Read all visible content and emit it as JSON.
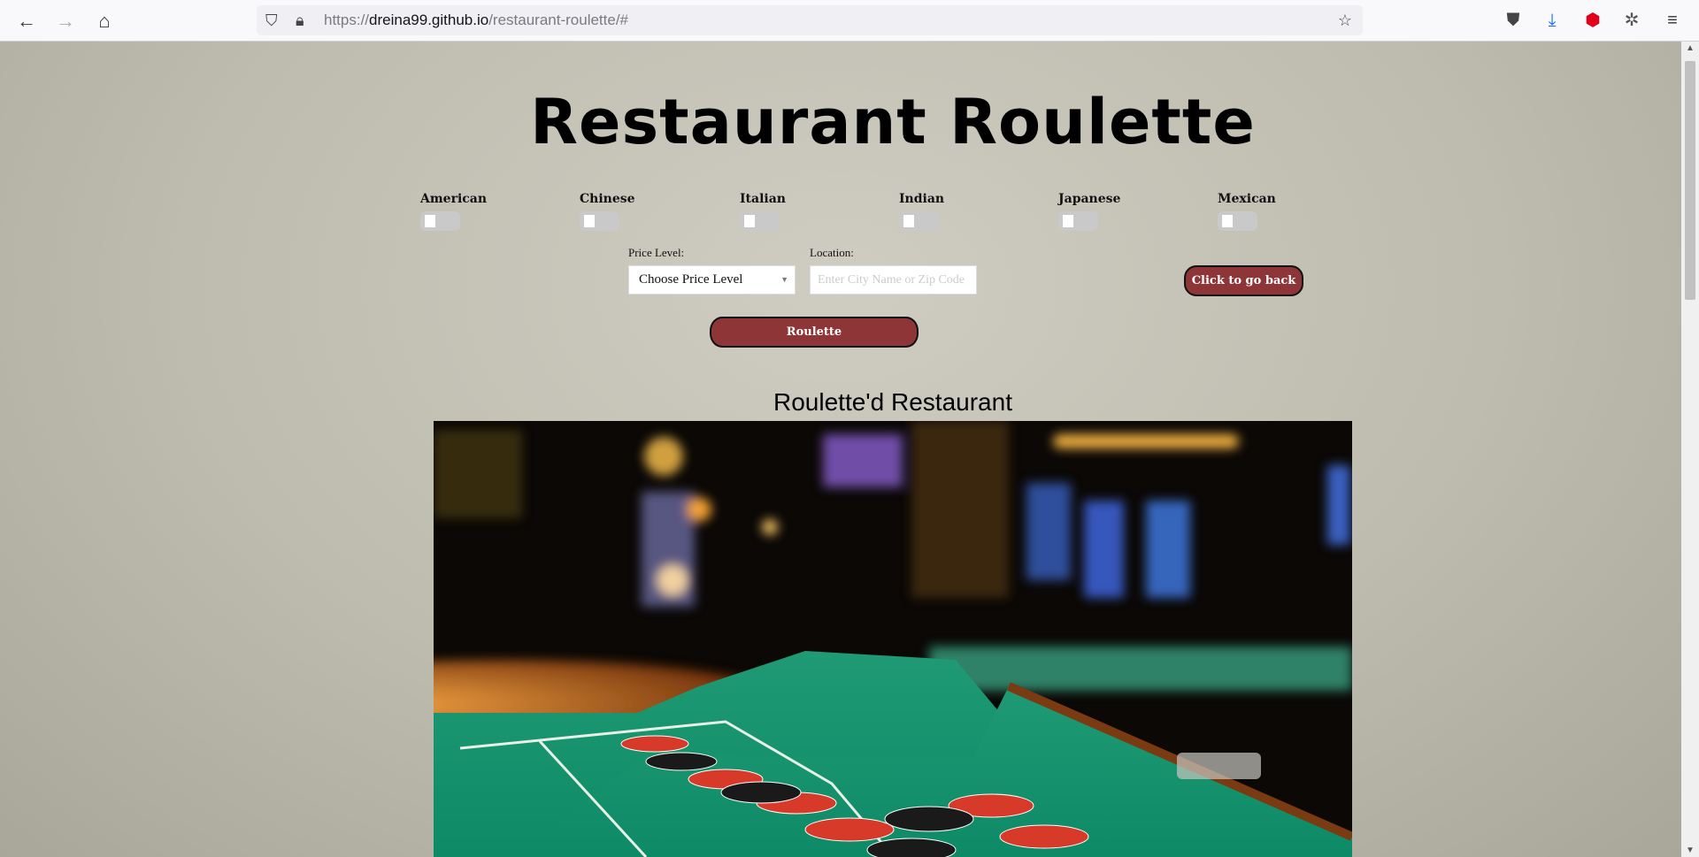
{
  "browser": {
    "url_prefix": "https://",
    "url_host": "dreina99.github.io",
    "url_path": "/restaurant-roulette/#",
    "icons": [
      "back-icon",
      "forward-icon",
      "home-icon",
      "shield-icon",
      "lock-icon",
      "bookmark-star-icon",
      "pocket-icon",
      "download-icon",
      "adblock-icon",
      "extension-icon",
      "menu-icon"
    ]
  },
  "page": {
    "title": "Restaurant Roulette",
    "cuisines": [
      {
        "label": "American",
        "checked": false
      },
      {
        "label": "Chinese",
        "checked": false
      },
      {
        "label": "Italian",
        "checked": false
      },
      {
        "label": "Indian",
        "checked": false
      },
      {
        "label": "Japanese",
        "checked": false
      },
      {
        "label": "Mexican",
        "checked": false
      }
    ],
    "price_label": "Price Level:",
    "price_value": "Choose Price Level",
    "location_label": "Location:",
    "location_placeholder": "Enter City Name or Zip Code",
    "location_value": "",
    "back_button": "Click to go back",
    "roulette_button": "Roulette",
    "result_heading": "Roulette'd Restaurant"
  },
  "colors": {
    "button": "#8e3538",
    "background": "#c4c2b5"
  }
}
